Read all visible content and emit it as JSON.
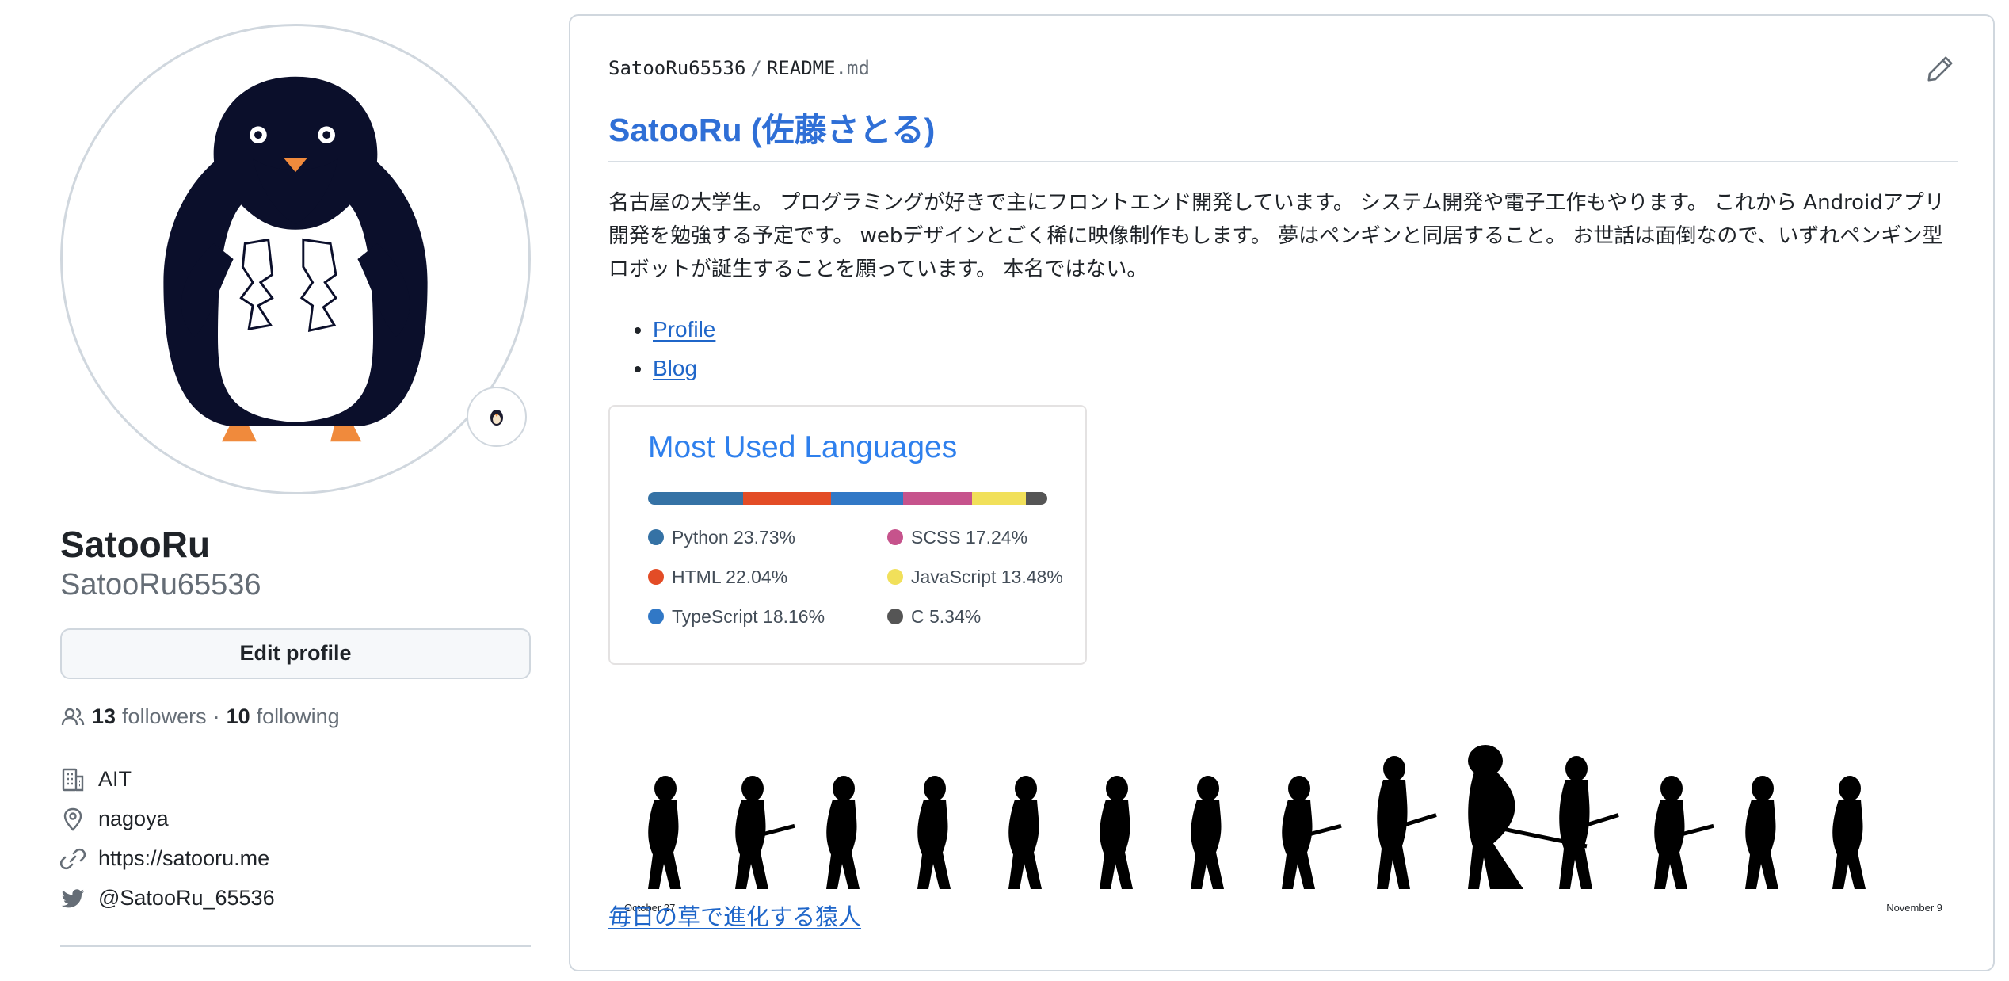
{
  "profile": {
    "fullname": "SatooRu",
    "username": "SatooRu65536",
    "edit_label": "Edit profile",
    "followers_count": "13",
    "followers_label": "followers",
    "dot": "·",
    "following_count": "10",
    "following_label": "following",
    "details": {
      "organization": "AIT",
      "location": "nagoya",
      "website": "https://satooru.me",
      "twitter": "@SatooRu_65536"
    }
  },
  "readme": {
    "path_user": "SatooRu65536",
    "path_sep": "/",
    "path_file": "README",
    "path_ext": ".md",
    "title": "SatooRu (佐藤さとる)",
    "description": "名古屋の大学生。 プログラミングが好きで主にフロントエンド開発しています。 システム開発や電子工作もやります。 これから Androidアプリ開発を勉強する予定です。 webデザインとごく稀に映像制作もします。 夢はペンギンと同居すること。 お世話は面倒なので、いずれペンギン型ロボットが誕生することを願っています。 本名ではない。",
    "links": [
      "Profile",
      "Blog"
    ],
    "evolution": {
      "start_date": "October 27",
      "end_date": "November 9",
      "link_label": "毎日の草で進化する猿人"
    }
  },
  "languages": {
    "title": "Most Used Languages",
    "items": [
      {
        "name": "Python",
        "percent": 23.73,
        "label": "Python 23.73%",
        "color": "#3572A5"
      },
      {
        "name": "HTML",
        "percent": 22.04,
        "label": "HTML 22.04%",
        "color": "#e34c26"
      },
      {
        "name": "TypeScript",
        "percent": 18.16,
        "label": "TypeScript 18.16%",
        "color": "#3178c6"
      },
      {
        "name": "SCSS",
        "percent": 17.24,
        "label": "SCSS 17.24%",
        "color": "#c6538c"
      },
      {
        "name": "JavaScript",
        "percent": 13.48,
        "label": "JavaScript 13.48%",
        "color": "#f1e05a"
      },
      {
        "name": "C",
        "percent": 5.34,
        "label": "C 5.34%",
        "color": "#555555"
      }
    ]
  },
  "icons": {
    "edit": "pencil-icon",
    "people": "people-icon",
    "organization": "organization-icon",
    "location": "location-icon",
    "website": "link-icon",
    "twitter": "twitter-icon"
  }
}
